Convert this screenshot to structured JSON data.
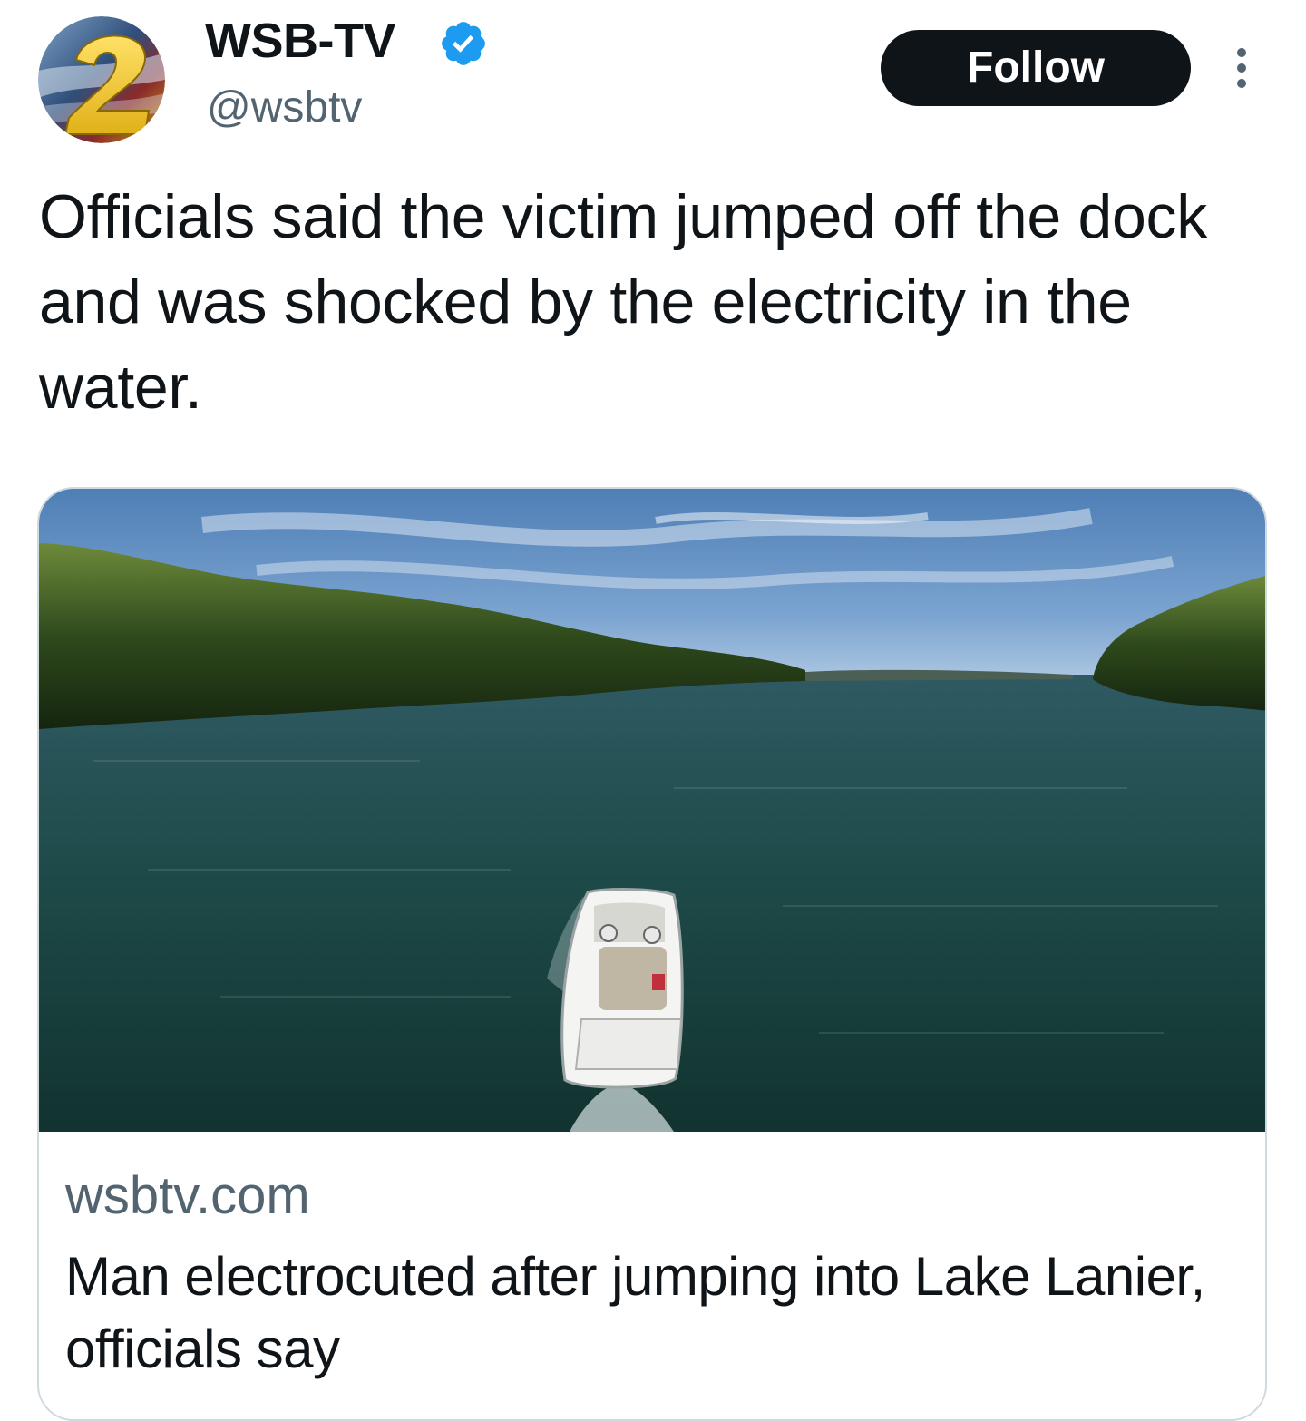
{
  "account": {
    "display_name": "WSB-TV",
    "handle": "@wsbtv",
    "verified": true,
    "avatar_logo": "2"
  },
  "actions": {
    "follow_label": "Follow",
    "more_icon": "more-dots-icon"
  },
  "tweet": {
    "text": "Officials said the victim jumped off the dock and was shocked by the electricity in the water."
  },
  "link_card": {
    "domain": "wsbtv.com",
    "title": "Man electrocuted after jumping into Lake Lanier, officials say"
  },
  "colors": {
    "text_primary": "#0f1419",
    "text_secondary": "#536471",
    "verified_blue": "#1d9bf0",
    "card_border": "#cfd9de",
    "button_bg": "#0f1419"
  }
}
